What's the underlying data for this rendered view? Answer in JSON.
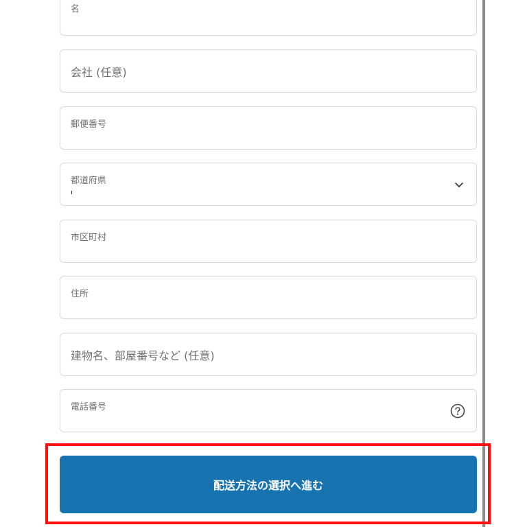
{
  "form": {
    "last_name_label": "名",
    "company_placeholder": "会社 (任意)",
    "postal_code_label": "郵便番号",
    "prefecture_label": "都道府県",
    "prefecture_value": "",
    "city_label": "市区町村",
    "address_label": "住所",
    "building_placeholder": "建物名、部屋番号など (任意)",
    "phone_label": "電話番号"
  },
  "submit": {
    "label": "配送方法の選択へ進む"
  },
  "icons": {
    "prefecture_dropdown": "chevron-down-icon",
    "phone_help": "help-circle-icon"
  },
  "colors": {
    "primary_button": "#1773b0",
    "highlight_border": "#ff1010",
    "field_border": "#d9d9d9"
  }
}
